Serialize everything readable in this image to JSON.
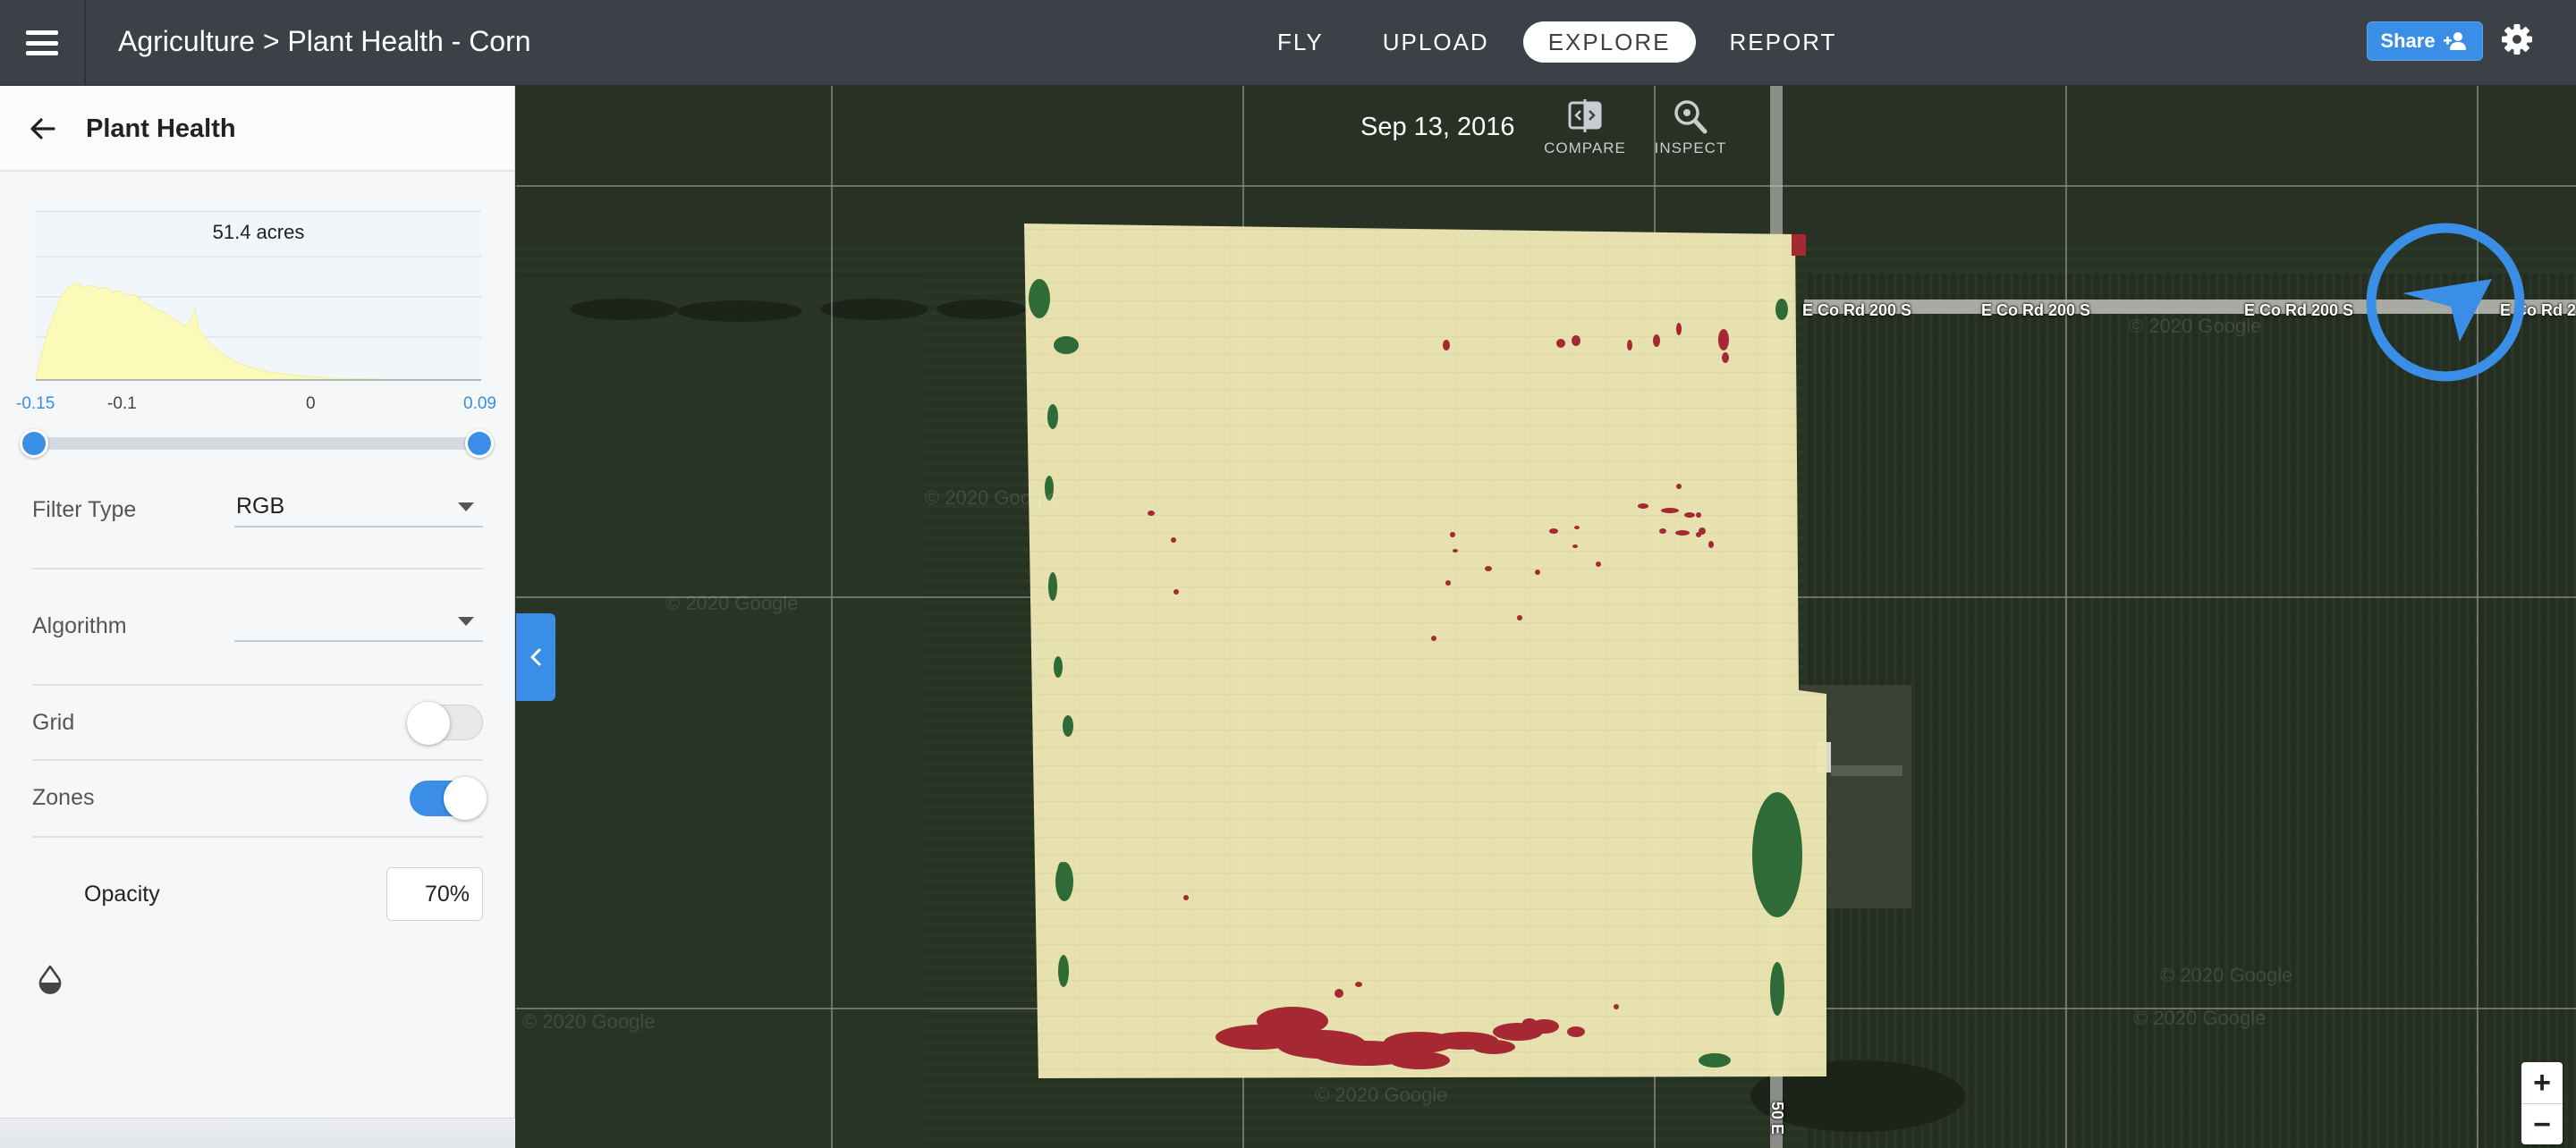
{
  "header": {
    "title": "Agriculture > Plant Health - Corn",
    "nav": [
      "FLY",
      "UPLOAD",
      "EXPLORE",
      "REPORT"
    ],
    "active_nav": "EXPLORE",
    "share_label": "Share"
  },
  "sidebar": {
    "title": "Plant Health",
    "histogram": {
      "acres_label": "51.4 acres",
      "ticks": [
        "-0.15",
        "-0.1",
        "0",
        "0.09"
      ],
      "range_min": -0.15,
      "range_max": 0.09
    },
    "filter_type": {
      "label": "Filter Type",
      "value": "RGB"
    },
    "algorithm": {
      "label": "Algorithm",
      "value": ""
    },
    "grid": {
      "label": "Grid",
      "on": false
    },
    "zones": {
      "label": "Zones",
      "on": true
    },
    "opacity": {
      "label": "Opacity",
      "value": "70%"
    }
  },
  "map": {
    "date": "Sep 13, 2016",
    "tools": [
      "COMPARE",
      "INSPECT"
    ],
    "roads": [
      "E Co Rd 200 S",
      "E Co Rd 200 S",
      "E Co Rd 200 S",
      "E Co Rd 2",
      "50 E"
    ],
    "watermark": "© 2020 Google",
    "zoom_in": "+",
    "zoom_out": "−"
  },
  "colors": {
    "accent": "#3a8ee6",
    "topbar": "#3c4148",
    "overlay_healthy": "#efeab3",
    "overlay_stressed": "#a62833",
    "overlay_green": "#2f6b36"
  }
}
